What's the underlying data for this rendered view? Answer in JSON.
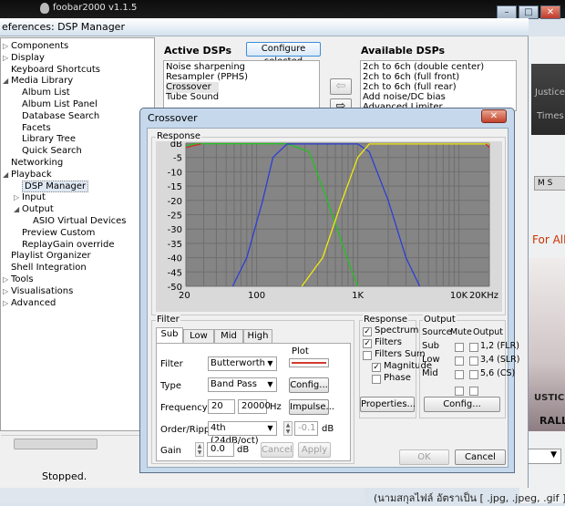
{
  "bg": {
    "app_title": "foobar2000 v1.1.5",
    "banner_line1": "Justice F",
    "banner_line2": "Times",
    "ms_label": "M S",
    "for_all_text": "For All",
    "album_text1": "USTICE",
    "album_text2": "RALL",
    "thai_text": "(นามสกุลไฟล์ อัตราเป็น [ .jpg, .jpeg, .gif ] และ"
  },
  "prefs": {
    "title": "eferences: DSP Manager",
    "tree": [
      {
        "label": "Components",
        "depth": 0,
        "arrow": "▷"
      },
      {
        "label": "Display",
        "depth": 0,
        "arrow": "▷"
      },
      {
        "label": "Keyboard Shortcuts",
        "depth": 0,
        "arrow": ""
      },
      {
        "label": "Media Library",
        "depth": 0,
        "arrow": "◢"
      },
      {
        "label": "Album List",
        "depth": 1,
        "arrow": ""
      },
      {
        "label": "Album List Panel",
        "depth": 1,
        "arrow": ""
      },
      {
        "label": "Database Search",
        "depth": 1,
        "arrow": ""
      },
      {
        "label": "Facets",
        "depth": 1,
        "arrow": ""
      },
      {
        "label": "Library Tree",
        "depth": 1,
        "arrow": ""
      },
      {
        "label": "Quick Search",
        "depth": 1,
        "arrow": ""
      },
      {
        "label": "Networking",
        "depth": 0,
        "arrow": ""
      },
      {
        "label": "Playback",
        "depth": 0,
        "arrow": "◢"
      },
      {
        "label": "DSP Manager",
        "depth": 1,
        "arrow": "",
        "selected": true
      },
      {
        "label": "Input",
        "depth": 1,
        "arrow": "▷"
      },
      {
        "label": "Output",
        "depth": 1,
        "arrow": "◢"
      },
      {
        "label": "ASIO Virtual Devices",
        "depth": 2,
        "arrow": ""
      },
      {
        "label": "Preview Custom",
        "depth": 1,
        "arrow": ""
      },
      {
        "label": "ReplayGain override",
        "depth": 1,
        "arrow": ""
      },
      {
        "label": "Playlist Organizer",
        "depth": 0,
        "arrow": ""
      },
      {
        "label": "Shell Integration",
        "depth": 0,
        "arrow": ""
      },
      {
        "label": "Tools",
        "depth": 0,
        "arrow": "▷"
      },
      {
        "label": "Visualisations",
        "depth": 0,
        "arrow": "▷"
      },
      {
        "label": "Advanced",
        "depth": 0,
        "arrow": "▷"
      }
    ],
    "active_dsps_label": "Active DSPs",
    "configure_selected": "Configure selected",
    "available_dsps_label": "Available DSPs",
    "active_dsps": [
      "Noise sharpening",
      "Resampler (PPHS)",
      "Crossover",
      "Tube Sound"
    ],
    "available_dsps": [
      "2ch to 6ch (double center)",
      "2ch to 6ch (full front)",
      "2ch to 6ch (full rear)",
      "Add noise/DC bias",
      "Advanced Limiter"
    ],
    "status": "Stopped."
  },
  "crossover": {
    "title": "Crossover",
    "close_glyph": "✕",
    "response_label": "Response",
    "filter_label": "Filter",
    "tabs": [
      "Sub",
      "Low",
      "Mid",
      "High"
    ],
    "active_tab": "Sub",
    "plot_label": "Plot",
    "filter_type_label": "Filter",
    "filter_type_value": "Butterworth",
    "type_label": "Type",
    "type_value": "Band Pass",
    "frequency_label": "Frequency",
    "frequency_low": "20",
    "frequency_high": "20000",
    "frequency_unit": "Hz",
    "order_label": "Order/Ripple",
    "order_value": "4th (24dB/oct)",
    "ripple_value": "-0.1",
    "ripple_unit": "dB",
    "gain_label": "Gain",
    "gain_value": "0.0",
    "gain_unit": "dB",
    "config_button": "Config...",
    "impulse_button": "Impulse...",
    "cancel_small": "Cancel",
    "apply_button": "Apply",
    "response_section": "Response",
    "checks": [
      {
        "label": "Spectrum",
        "checked": true
      },
      {
        "label": "Filters",
        "checked": true
      },
      {
        "label": "Filters Sum",
        "checked": false
      },
      {
        "label": "Magnitude",
        "checked": true
      },
      {
        "label": "Phase",
        "checked": false
      }
    ],
    "properties_button": "Properties...",
    "output_section": "Output",
    "output_headers": [
      "Source",
      "Mute",
      "Output"
    ],
    "output_rows": [
      {
        "source": "Sub",
        "mute": false,
        "output": "1,2 (FLR)"
      },
      {
        "source": "Low",
        "mute": false,
        "output": "3,4 (SLR)"
      },
      {
        "source": "Mid",
        "mute": false,
        "output": "5,6 (CS)"
      }
    ],
    "output_config_button": "Config...",
    "ok_button": "OK",
    "cancel_button": "Cancel",
    "colors": {
      "sub": "#e8e8e8",
      "low": "#2c3fd6",
      "mid": "#22c21f",
      "high": "#f2ea10",
      "sum": "#d22b2b",
      "plot_bg": "#858585"
    }
  },
  "chart_data": {
    "type": "line",
    "title": "Response",
    "x_scale": "log",
    "xlim": [
      20,
      20000
    ],
    "ylim": [
      -50,
      0
    ],
    "y_unit_label": "dB",
    "x_ticks": [
      {
        "v": 20,
        "label": "20"
      },
      {
        "v": 100,
        "label": "100"
      },
      {
        "v": 1000,
        "label": "1K"
      },
      {
        "v": 10000,
        "label": "10K"
      },
      {
        "v": 20000,
        "label": "20KHz"
      }
    ],
    "y_ticks": [
      {
        "v": 0,
        "label": "dB"
      },
      {
        "v": -5,
        "label": "-5"
      },
      {
        "v": -10,
        "label": "-10"
      },
      {
        "v": -15,
        "label": "-15"
      },
      {
        "v": -20,
        "label": "-20"
      },
      {
        "v": -25,
        "label": "-25"
      },
      {
        "v": -30,
        "label": "-30"
      },
      {
        "v": -35,
        "label": "-35"
      },
      {
        "v": -40,
        "label": "-40"
      },
      {
        "v": -45,
        "label": "-45"
      },
      {
        "v": -50,
        "label": "-50"
      }
    ],
    "grid": true,
    "series": [
      {
        "key": "mid",
        "points": [
          [
            20,
            -1
          ],
          [
            25,
            -0.2
          ],
          [
            200,
            -0.2
          ],
          [
            330,
            -3
          ],
          [
            500,
            -20
          ],
          [
            820,
            -42
          ],
          [
            1000,
            -50
          ]
        ]
      },
      {
        "key": "low",
        "points": [
          [
            58,
            -50
          ],
          [
            80,
            -40
          ],
          [
            115,
            -20
          ],
          [
            145,
            -5
          ],
          [
            200,
            -0.3
          ],
          [
            1000,
            -0.3
          ],
          [
            1300,
            -3
          ],
          [
            2000,
            -20
          ],
          [
            3000,
            -40
          ],
          [
            4100,
            -50
          ]
        ]
      },
      {
        "key": "high",
        "points": [
          [
            280,
            -50
          ],
          [
            450,
            -40
          ],
          [
            700,
            -20
          ],
          [
            1000,
            -5
          ],
          [
            1300,
            -0.3
          ],
          [
            20000,
            -0.3
          ]
        ]
      }
    ]
  }
}
